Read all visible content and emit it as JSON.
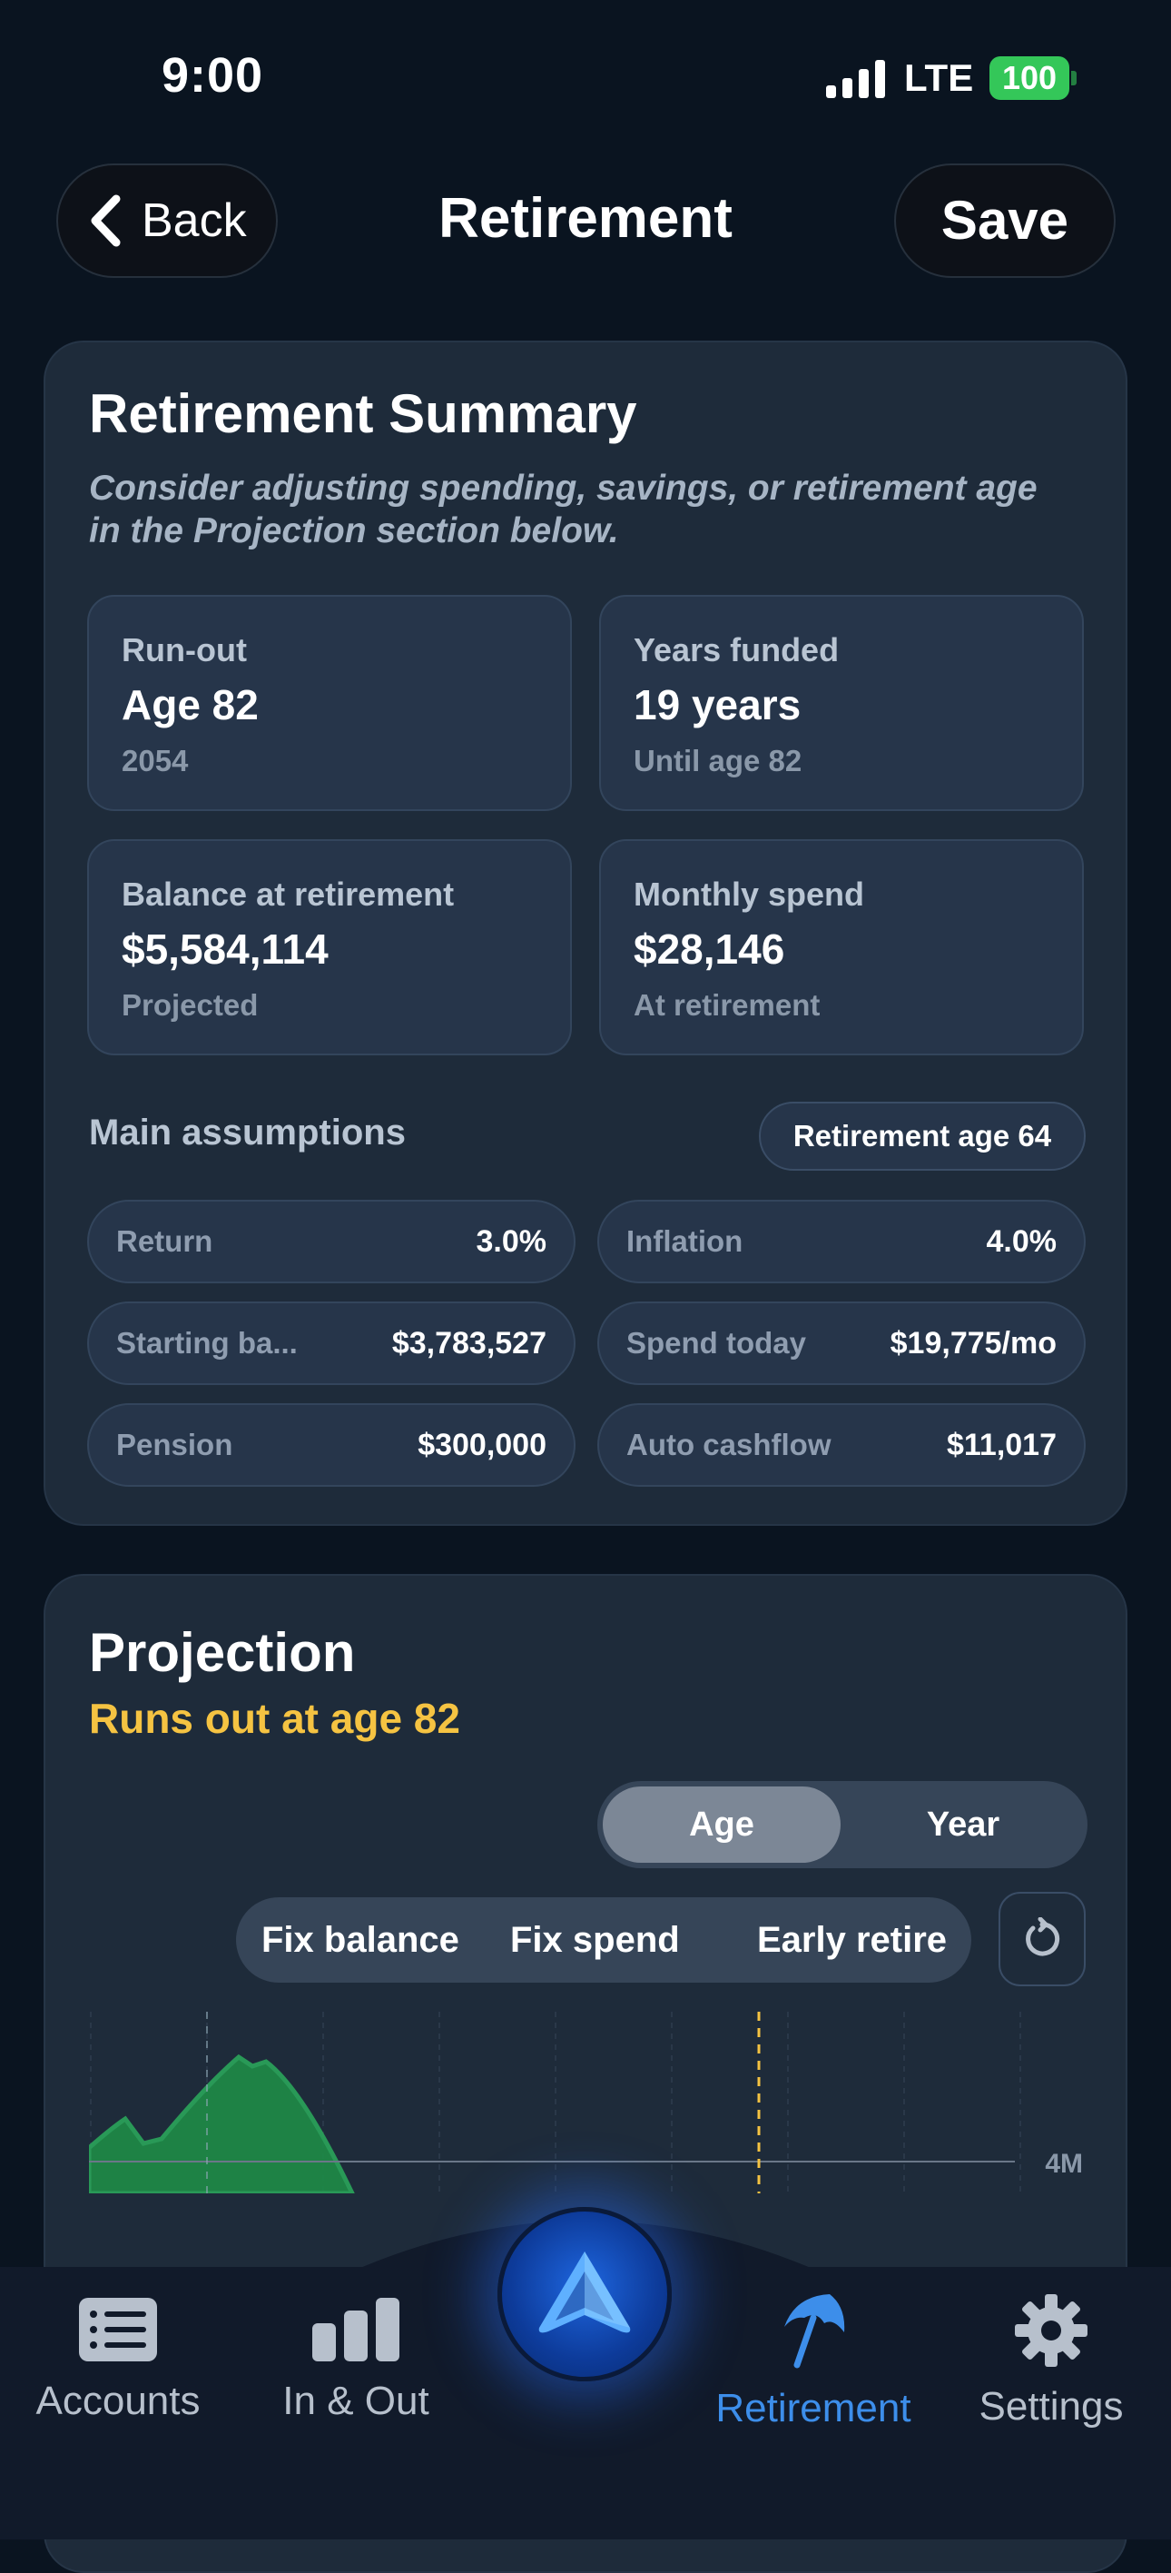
{
  "status_bar": {
    "time": "9:00",
    "network": "LTE",
    "battery": "100"
  },
  "header": {
    "back_label": "Back",
    "title": "Retirement",
    "save_label": "Save"
  },
  "summary": {
    "title": "Retirement Summary",
    "subtitle": "Consider adjusting spending, savings, or retirement age in the Projection section below.",
    "stats": [
      {
        "label": "Run-out",
        "value": "Age 82",
        "sub": "2054"
      },
      {
        "label": "Years funded",
        "value": "19 years",
        "sub": "Until age 82"
      },
      {
        "label": "Balance at retirement",
        "value": "$5,584,114",
        "sub": "Projected"
      },
      {
        "label": "Monthly spend",
        "value": "$28,146",
        "sub": "At retirement"
      }
    ],
    "assumptions_title": "Main assumptions",
    "retirement_age_badge": "Retirement age 64",
    "assumptions": [
      {
        "key": "Return",
        "value": "3.0%"
      },
      {
        "key": "Inflation",
        "value": "4.0%"
      },
      {
        "key": "Starting ba...",
        "value": "$3,783,527"
      },
      {
        "key": "Spend today",
        "value": "$19,775/mo"
      },
      {
        "key": "Pension",
        "value": "$300,000"
      },
      {
        "key": "Auto cashflow",
        "value": "$11,017"
      }
    ]
  },
  "projection": {
    "title": "Projection",
    "status": "Runs out at age 82",
    "toggle": {
      "age": "Age",
      "year": "Year",
      "selected": "Age"
    },
    "actions": [
      "Fix balance",
      "Fix spend",
      "Early retire"
    ],
    "chart_label": "4M"
  },
  "tabbar": {
    "tabs": [
      {
        "label": "Accounts",
        "icon": "list-icon"
      },
      {
        "label": "In & Out",
        "icon": "bar-chart-icon"
      },
      {
        "label": "Retirement",
        "icon": "umbrella-icon",
        "active": true
      },
      {
        "label": "Settings",
        "icon": "gear-icon"
      }
    ]
  },
  "colors": {
    "accent": "#3d8eea",
    "warning": "#f5c342",
    "positive": "#2ea35a",
    "battery": "#34c759"
  }
}
